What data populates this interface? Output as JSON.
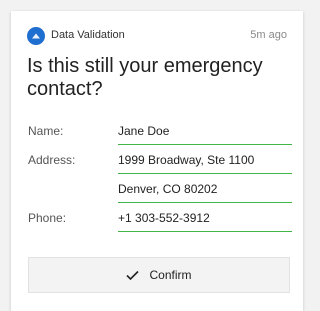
{
  "header": {
    "app_name": "Data Validation",
    "timestamp": "5m ago",
    "icon": "sap-logo-icon"
  },
  "question": "Is this still your emergency contact?",
  "fields": {
    "name": {
      "label": "Name:",
      "value": "Jane Doe"
    },
    "address": {
      "label": "Address:",
      "value_line1": "1999 Broadway, Ste 1100",
      "value_line2": "Denver, CO 80202"
    },
    "phone": {
      "label": "Phone:",
      "value": "+1 303-552-3912"
    }
  },
  "confirm_button": {
    "label": "Confirm",
    "icon": "check-icon"
  },
  "colors": {
    "accent_underline": "#43b649",
    "app_icon": "#1f6fd1"
  }
}
